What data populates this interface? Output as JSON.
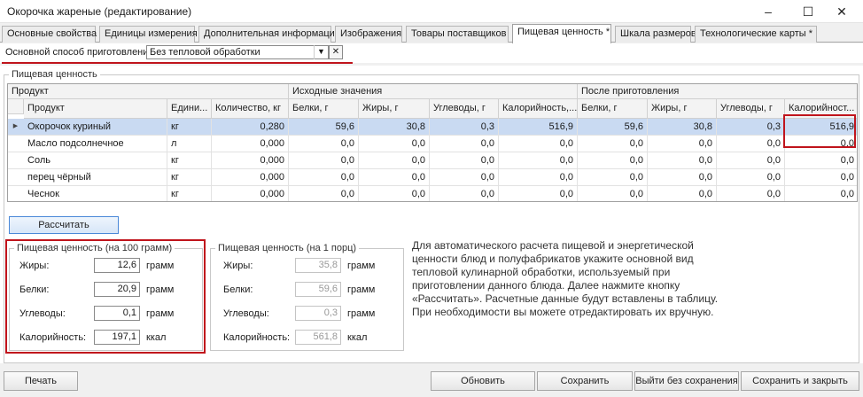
{
  "window": {
    "title": "Окорочка жареные  (редактирование)",
    "min_icon": "–",
    "max_icon": "☐",
    "close_icon": "✕"
  },
  "tabs": [
    {
      "label": "Основные свойства"
    },
    {
      "label": "Единицы измерения"
    },
    {
      "label": "Дополнительная информация"
    },
    {
      "label": "Изображения"
    },
    {
      "label": "Товары поставщиков"
    },
    {
      "label": "Пищевая ценность *"
    },
    {
      "label": "Шкала размеров"
    },
    {
      "label": "Технологические карты *"
    }
  ],
  "method": {
    "label": "Основной способ приготовления:",
    "value": "Без тепловой обработки",
    "dd_icon": "▼",
    "clear_icon": "✕"
  },
  "nutrition_group": {
    "title": "Пищевая ценность"
  },
  "grid": {
    "group_headers": {
      "product": "Продукт",
      "source": "Исходные значения",
      "after": "После приготовления"
    },
    "columns": [
      "Продукт",
      "Едини...",
      "Количество, кг",
      "Белки, г",
      "Жиры, г",
      "Углеводы, г",
      "Калорийность,...",
      "Белки, г",
      "Жиры, г",
      "Углеводы, г",
      "Калорийност..."
    ],
    "row_marker": "▶",
    "rows": [
      [
        "Окорочок куриный",
        "кг",
        "0,280",
        "59,6",
        "30,8",
        "0,3",
        "516,9",
        "59,6",
        "30,8",
        "0,3",
        "516,9"
      ],
      [
        "Масло подсолнечное",
        "л",
        "0,000",
        "0,0",
        "0,0",
        "0,0",
        "0,0",
        "0,0",
        "0,0",
        "0,0",
        "0,0"
      ],
      [
        "Соль",
        "кг",
        "0,000",
        "0,0",
        "0,0",
        "0,0",
        "0,0",
        "0,0",
        "0,0",
        "0,0",
        "0,0"
      ],
      [
        "перец чёрный",
        "кг",
        "0,000",
        "0,0",
        "0,0",
        "0,0",
        "0,0",
        "0,0",
        "0,0",
        "0,0",
        "0,0"
      ],
      [
        "Чеснок",
        "кг",
        "0,000",
        "0,0",
        "0,0",
        "0,0",
        "0,0",
        "0,0",
        "0,0",
        "0,0",
        "0,0"
      ]
    ]
  },
  "calc_button": "Рассчитать",
  "per100": {
    "title": "Пищевая ценность (на 100 грамм)",
    "items": [
      {
        "label": "Жиры:",
        "value": "12,6",
        "unit": "грамм"
      },
      {
        "label": "Белки:",
        "value": "20,9",
        "unit": "грамм"
      },
      {
        "label": "Углеводы:",
        "value": "0,1",
        "unit": "грамм"
      },
      {
        "label": "Калорийность:",
        "value": "197,1",
        "unit": "ккал"
      }
    ]
  },
  "per_portion": {
    "title": "Пищевая ценность (на 1 порц)",
    "items": [
      {
        "label": "Жиры:",
        "value": "35,8",
        "unit": "грамм"
      },
      {
        "label": "Белки:",
        "value": "59,6",
        "unit": "грамм"
      },
      {
        "label": "Углеводы:",
        "value": "0,3",
        "unit": "грамм"
      },
      {
        "label": "Калорийность:",
        "value": "561,8",
        "unit": "ккал"
      }
    ]
  },
  "hint": "Для автоматического расчета пищевой и энергетической ценности блюд и полуфабрикатов укажите основной вид тепловой кулинарной обработки, используемый при приготовлении данного блюда. Далее нажмите кнопку «Рассчитать». Расчетные данные будут вставлены в таблицу. При необходимости вы можете отредактировать их вручную.",
  "footer": {
    "print": "Печать",
    "refresh": "Обновить",
    "save": "Сохранить",
    "exit": "Выйти без сохранения",
    "save_close": "Сохранить и закрыть"
  },
  "colors": {
    "highlight": "#c0141c",
    "selected_row": "#c9daf2"
  }
}
